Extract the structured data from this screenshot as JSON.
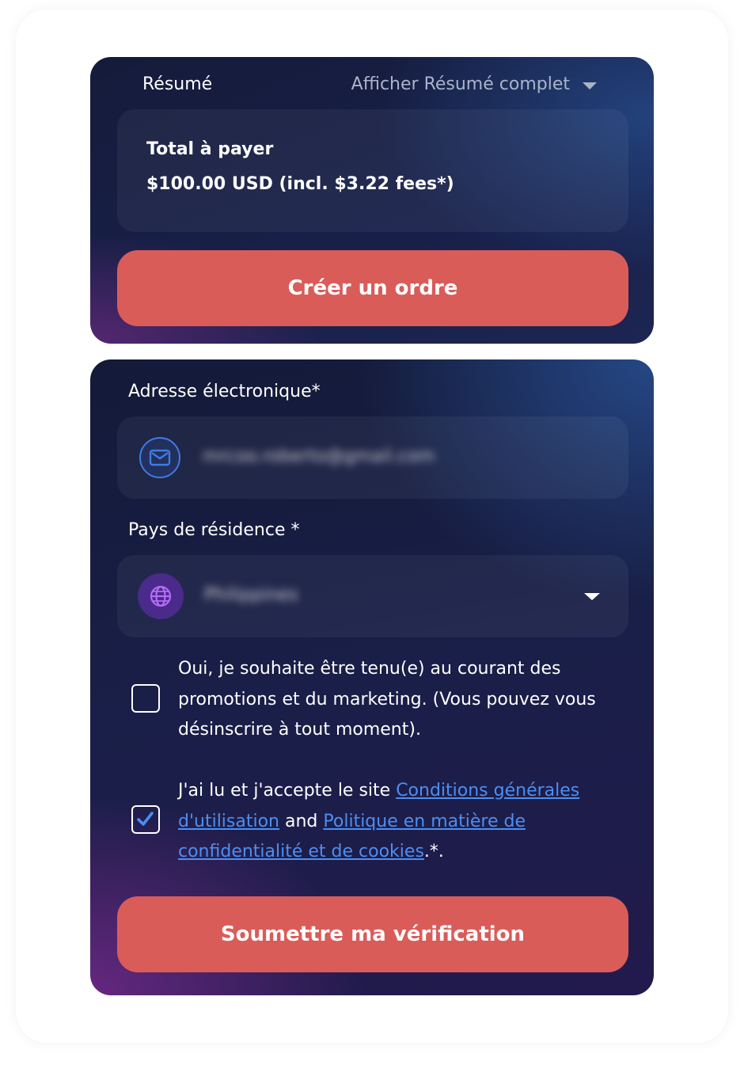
{
  "summary": {
    "label": "Résumé",
    "toggle_label": "Afficher Résumé complet",
    "total_title": "Total à payer",
    "total_value": "$100.00 USD (incl. $3.22 fees*)",
    "order_button": "Créer un ordre"
  },
  "form": {
    "email": {
      "label": "Adresse électronique*",
      "value": "mrcoo.roberto@gmail.com"
    },
    "country": {
      "label": "Pays de résidence *",
      "value": "Philippines"
    },
    "marketing": {
      "checked": false,
      "text": "Oui, je souhaite être tenu(e) au courant des promotions et du marketing. (Vous pouvez vous désinscrire à tout moment)."
    },
    "terms": {
      "checked": true,
      "text_before": "J'ai lu et j'accepte le site ",
      "link_terms": "Conditions générales d'utilisation",
      "text_and": " and ",
      "link_privacy": "Politique en matière de confidentialité et de cookies",
      "text_after": ".*."
    },
    "submit_button": "Soumettre ma vérification"
  },
  "icons": {
    "toggle": "chevron-down-icon",
    "email": "mail-icon",
    "country": "globe-icon",
    "select": "chevron-down-icon",
    "checkmark": "check-icon"
  },
  "colors": {
    "accent_button": "#d95c59",
    "link": "#4d8ef0",
    "mail_icon": "#3f7ce0",
    "globe_icon": "#b36cf5"
  }
}
